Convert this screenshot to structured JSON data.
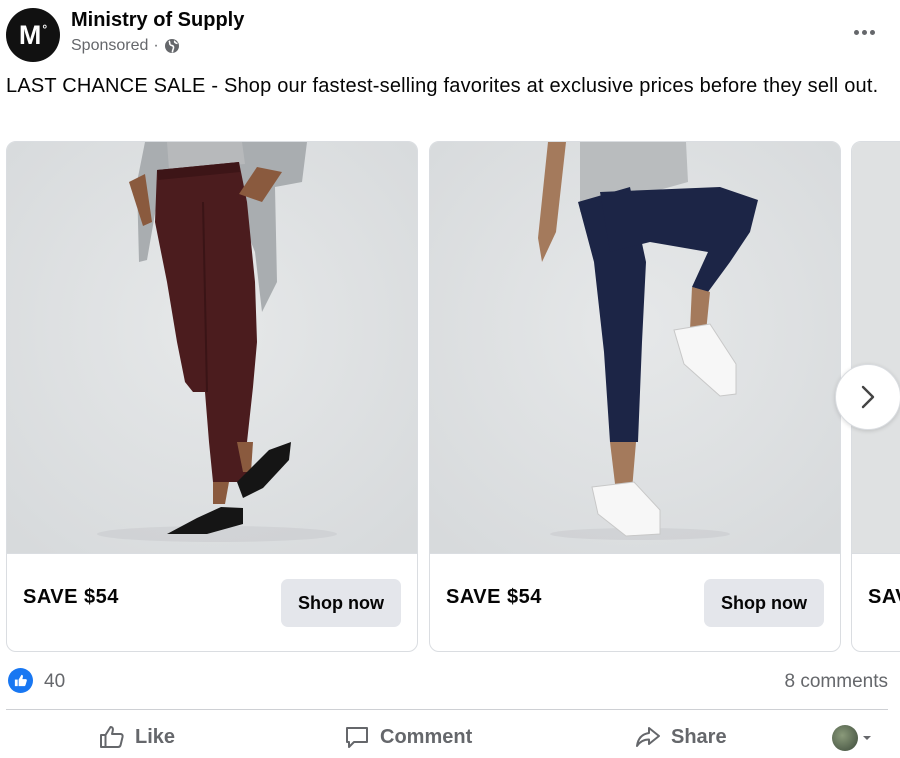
{
  "post": {
    "page_name": "Ministry of Supply",
    "avatar_letter": "M",
    "avatar_mark": "°",
    "sponsored_label": "Sponsored",
    "meta_separator": "·",
    "body_text": "LAST CHANCE SALE - Shop our fastest-selling favorites at exclusive prices before they sell out."
  },
  "carousel": {
    "cards": [
      {
        "headline": "SAVE $54",
        "button_label": "Shop now",
        "image_icon": "product-photo-burgundy-pants"
      },
      {
        "headline": "SAVE $54",
        "button_label": "Shop now",
        "image_icon": "product-photo-navy-pants"
      },
      {
        "headline": "SAV"
      }
    ],
    "next_icon": "chevron-right-icon"
  },
  "stats": {
    "like_count": "40",
    "comments_label": "8 comments"
  },
  "actions": {
    "like_label": "Like",
    "comment_label": "Comment",
    "share_label": "Share"
  },
  "colors": {
    "accent": "#1877f2",
    "secondary_text": "#65676b",
    "button_bg": "#e4e6eb",
    "image_bg": "#dfe1e2"
  }
}
